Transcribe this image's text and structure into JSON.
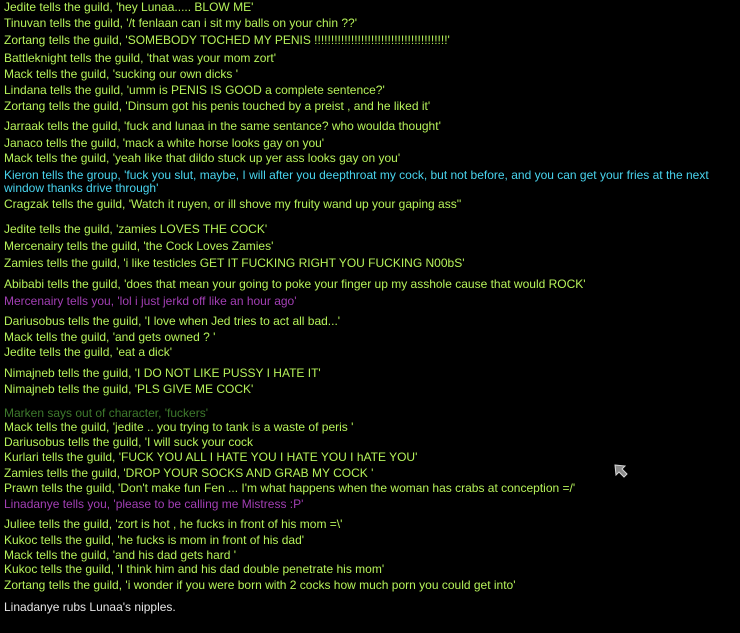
{
  "colors": {
    "guild": "#b6f25a",
    "tell": "#a23fb4",
    "group": "#49d4ee",
    "ooc": "#3e7a2c",
    "emote": "#e6e6e6",
    "background": "#000000"
  },
  "cursor_icon": "mouse-pointer-icon",
  "messages": [
    {
      "text": "Jedite tells the guild, 'hey Lunaa..... BLOW ME'",
      "channel": "guild"
    },
    {
      "text": "Tinuvan tells the guild, '/t fenlaan can i sit my balls on your chin ??'",
      "channel": "guild"
    },
    {
      "text": "Zortang tells the guild, 'SOMEBODY TOCHED MY PENIS !!!!!!!!!!!!!!!!!!!!!!!!!!!!!!!!!!!!!!!!'",
      "channel": "guild"
    },
    {
      "text": "Battleknight tells the guild, 'that was your mom zort'",
      "channel": "guild"
    },
    {
      "text": "Mack tells the guild, 'sucking our own dicks '",
      "channel": "guild"
    },
    {
      "text": "Lindana tells the guild, 'umm is PENIS IS GOOD a complete sentence?'",
      "channel": "guild"
    },
    {
      "text": "Zortang tells the guild, 'Dinsum got his penis touched by a preist , and he liked it'",
      "channel": "guild"
    },
    {
      "text": "Jarraak tells the guild, 'fuck and lunaa in the same sentance? who woulda thought'",
      "channel": "guild"
    },
    {
      "text": "Janaco tells the guild, 'mack a white horse looks gay on you'",
      "channel": "guild"
    },
    {
      "text": "Mack tells the guild, 'yeah like that dildo stuck up yer ass looks gay on you'",
      "channel": "guild"
    },
    {
      "text": "Kieron tells the group, 'fuck you slut, maybe, I will after you deepthroat my cock, but not before, and you can get your fries at the next window thanks drive through'",
      "channel": "group"
    },
    {
      "text": "Cragzak tells the guild, 'Watch it ruyen, or ill shove my fruity wand up your gaping ass''",
      "channel": "guild"
    },
    {
      "text": "Jedite tells the guild, 'zamies LOVES THE COCK'",
      "channel": "guild"
    },
    {
      "text": "Mercenairy tells the guild, 'the Cock Loves Zamies'",
      "channel": "guild"
    },
    {
      "text": "Zamies tells the guild, 'i like testicles GET IT FUCKING RIGHT YOU FUCKING N00bS'",
      "channel": "guild"
    },
    {
      "text": "Abibabi tells the guild, 'does that mean your going to poke your finger up my asshole cause that would ROCK'",
      "channel": "guild"
    },
    {
      "text": "Mercenairy tells you, 'lol i just jerkd off like an hour ago'",
      "channel": "tell"
    },
    {
      "text": "Dariusobus tells the guild, 'I love when Jed tries to act all bad...'",
      "channel": "guild"
    },
    {
      "text": "Mack tells the guild, 'and gets owned ? '",
      "channel": "guild"
    },
    {
      "text": "Jedite tells the guild, 'eat a dick'",
      "channel": "guild"
    },
    {
      "text": "Nimajneb tells the guild, 'I DO NOT LIKE PUSSY I HATE IT'",
      "channel": "guild"
    },
    {
      "text": "Nimajneb tells the guild, 'PLS GIVE ME COCK'",
      "channel": "guild"
    },
    {
      "text": "Marken says out of character, 'fuckers'",
      "channel": "ooc"
    },
    {
      "text": "Mack tells the guild, 'jedite .. you trying to tank is a waste of peris '",
      "channel": "guild"
    },
    {
      "text": "Dariusobus tells the guild, 'I will suck your cock",
      "channel": "guild"
    },
    {
      "text": "Kurlari tells the guild, 'FUCK YOU ALL I HATE YOU I HATE YOU I hATE YOU'",
      "channel": "guild"
    },
    {
      "text": "Zamies tells the guild, 'DROP YOUR SOCKS AND GRAB MY COCK '",
      "channel": "guild"
    },
    {
      "text": "Prawn tells the guild, 'Don't make fun Fen ... I'm what happens when the woman has crabs at conception =/'",
      "channel": "guild"
    },
    {
      "text": "Linadanye tells you, 'please to be calling me Mistress :P'",
      "channel": "tell"
    },
    {
      "text": "Juliee tells the guild, 'zort is hot , he fucks in front of his mom =\\'",
      "channel": "guild"
    },
    {
      "text": "Kukoc tells the guild, 'he fucks is mom in front of his dad'",
      "channel": "guild"
    },
    {
      "text": "Mack tells the guild, 'and his dad gets hard '",
      "channel": "guild"
    },
    {
      "text": "Kukoc tells the guild, 'I think him and his dad double penetrate his mom'",
      "channel": "guild"
    },
    {
      "text": "Zortang tells the guild, 'i wonder if you were born with 2 cocks how much porn you could get into'",
      "channel": "guild"
    },
    {
      "text": "Linadanye rubs Lunaa's nipples.",
      "channel": "emote"
    }
  ]
}
